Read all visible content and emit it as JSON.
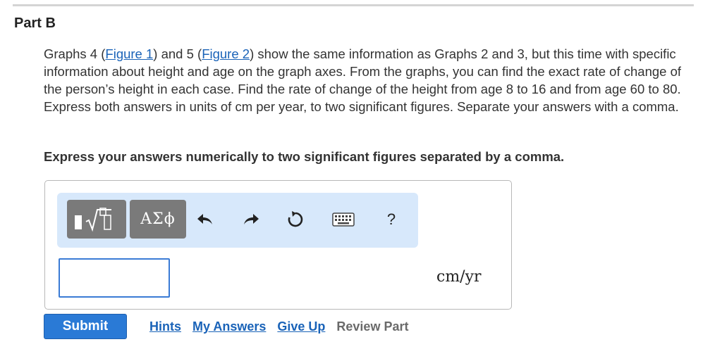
{
  "part": {
    "title": "Part B"
  },
  "question": {
    "intro_a": "Graphs 4 (",
    "figure1_link": "Figure 1",
    "intro_b": ") and 5 (",
    "figure2_link": "Figure 2",
    "intro_c": ") show the same information as Graphs 2 and 3, but this time with specific information about height and age on the graph axes. From the graphs, you can find the exact rate of change of the person’s height in each case. Find the rate of change of the height from age 8 to 16 and from age 60 to 80. Express both answers in units of cm per year, to two significant figures. Separate your answers with a comma."
  },
  "instruction": "Express your answers numerically to two significant figures separated by a comma.",
  "toolbar": {
    "templates_icon": "templates-sqrt-icon",
    "symbols_label": "ΑΣϕ",
    "undo_icon": "undo-icon",
    "redo_icon": "redo-icon",
    "reset_icon": "reset-icon",
    "keyboard_icon": "keyboard-icon",
    "help_label": "?"
  },
  "answer": {
    "value": "",
    "units": "cm/yr"
  },
  "actions": {
    "submit": "Submit",
    "hints": "Hints",
    "my_answers": "My Answers",
    "give_up": "Give Up",
    "review_part": "Review Part"
  },
  "colors": {
    "link": "#1a63b8",
    "submit_bg": "#2a7ad6",
    "toolbar_bg": "#d7e8fb",
    "input_border": "#3a7bd5"
  }
}
